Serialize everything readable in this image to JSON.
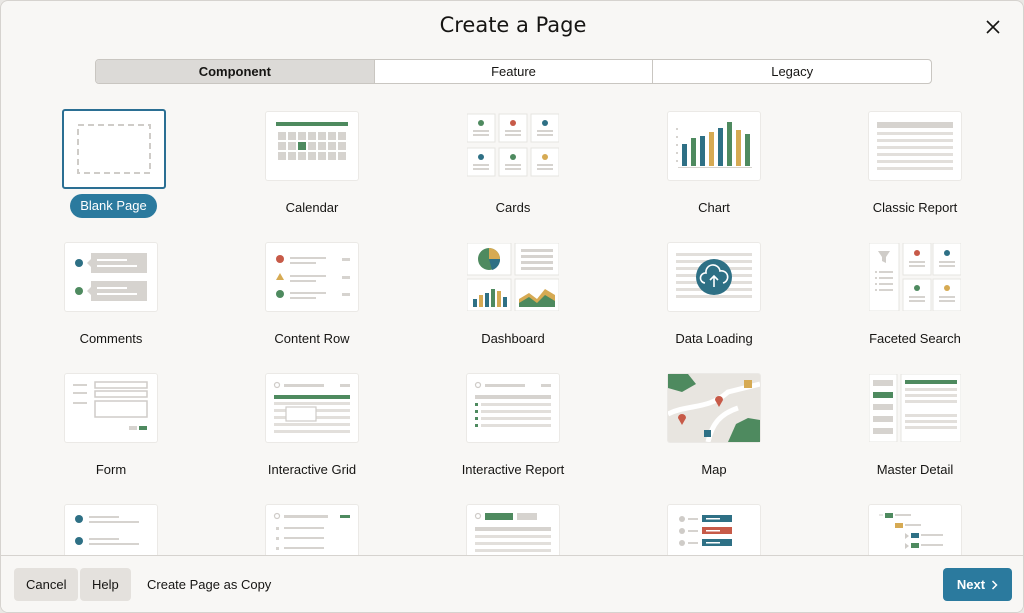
{
  "dialog": {
    "title": "Create a Page"
  },
  "tabs": [
    {
      "label": "Component",
      "active": true
    },
    {
      "label": "Feature",
      "active": false
    },
    {
      "label": "Legacy",
      "active": false
    }
  ],
  "items": [
    {
      "label": "Blank Page",
      "selected": true
    },
    {
      "label": "Calendar"
    },
    {
      "label": "Cards"
    },
    {
      "label": "Chart"
    },
    {
      "label": "Classic Report"
    },
    {
      "label": "Comments"
    },
    {
      "label": "Content Row"
    },
    {
      "label": "Dashboard"
    },
    {
      "label": "Data Loading"
    },
    {
      "label": "Faceted Search"
    },
    {
      "label": "Form"
    },
    {
      "label": "Interactive Grid"
    },
    {
      "label": "Interactive Report"
    },
    {
      "label": "Map"
    },
    {
      "label": "Master Detail"
    }
  ],
  "footer": {
    "cancel_label": "Cancel",
    "help_label": "Help",
    "copy_label": "Create Page as Copy",
    "next_label": "Next"
  },
  "colors": {
    "accent": "#2b7a9e",
    "green": "#4e8a5f",
    "red": "#c75a48",
    "gold": "#d6aa53",
    "teal": "#2e7085"
  }
}
